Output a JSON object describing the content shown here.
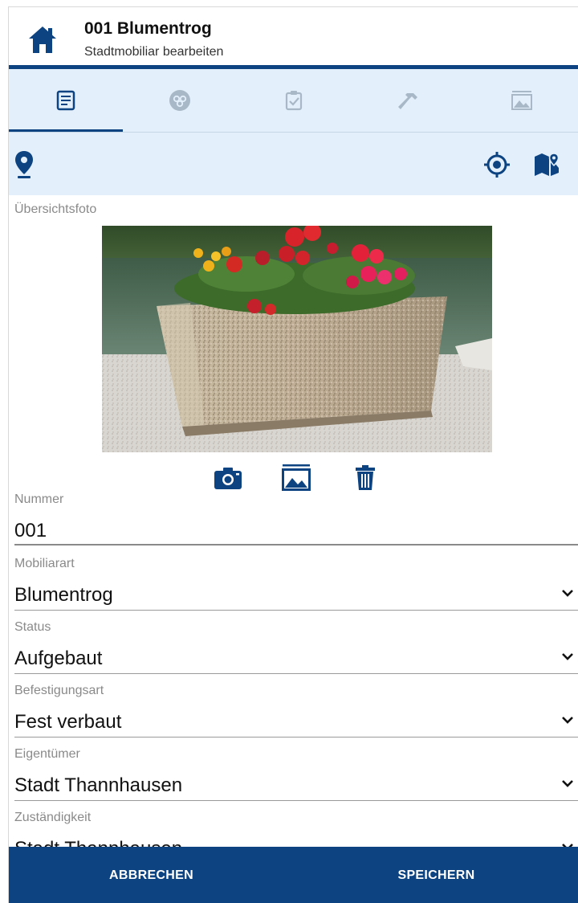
{
  "header": {
    "title": "001 Blumentrog",
    "subtitle": "Stadtmobiliar bearbeiten",
    "home_icon": "home-icon"
  },
  "tabs": [
    {
      "icon": "document-icon",
      "active": true
    },
    {
      "icon": "group-icon",
      "active": false
    },
    {
      "icon": "clipboard-check-icon",
      "active": false
    },
    {
      "icon": "hammer-icon",
      "active": false
    },
    {
      "icon": "image-gallery-icon",
      "active": false
    }
  ],
  "location_bar": {
    "pin_icon": "location-pin-icon",
    "target_icon": "gps-target-icon",
    "map_icon": "map-marker-icon"
  },
  "photo": {
    "label": "Übersichtsfoto",
    "actions": [
      "camera-icon",
      "gallery-icon",
      "trash-icon"
    ]
  },
  "fields": [
    {
      "label": "Nummer",
      "value": "001",
      "type": "text"
    },
    {
      "label": "Mobiliarart",
      "value": "Blumentrog",
      "type": "select"
    },
    {
      "label": "Status",
      "value": "Aufgebaut",
      "type": "select"
    },
    {
      "label": "Befestigungsart",
      "value": "Fest verbaut",
      "type": "select"
    },
    {
      "label": "Eigentümer",
      "value": "Stadt Thannhausen",
      "type": "select"
    },
    {
      "label": "Zuständigkeit",
      "value": "Stadt Thannhausen",
      "type": "select"
    }
  ],
  "actions": {
    "cancel_label": "ABBRECHEN",
    "save_label": "SPEICHERN"
  },
  "colors": {
    "primary": "#0d4380",
    "tab_background": "#e3f0fb",
    "inactive_icon": "#a9b8c6",
    "label_gray": "#8a8a8a"
  }
}
